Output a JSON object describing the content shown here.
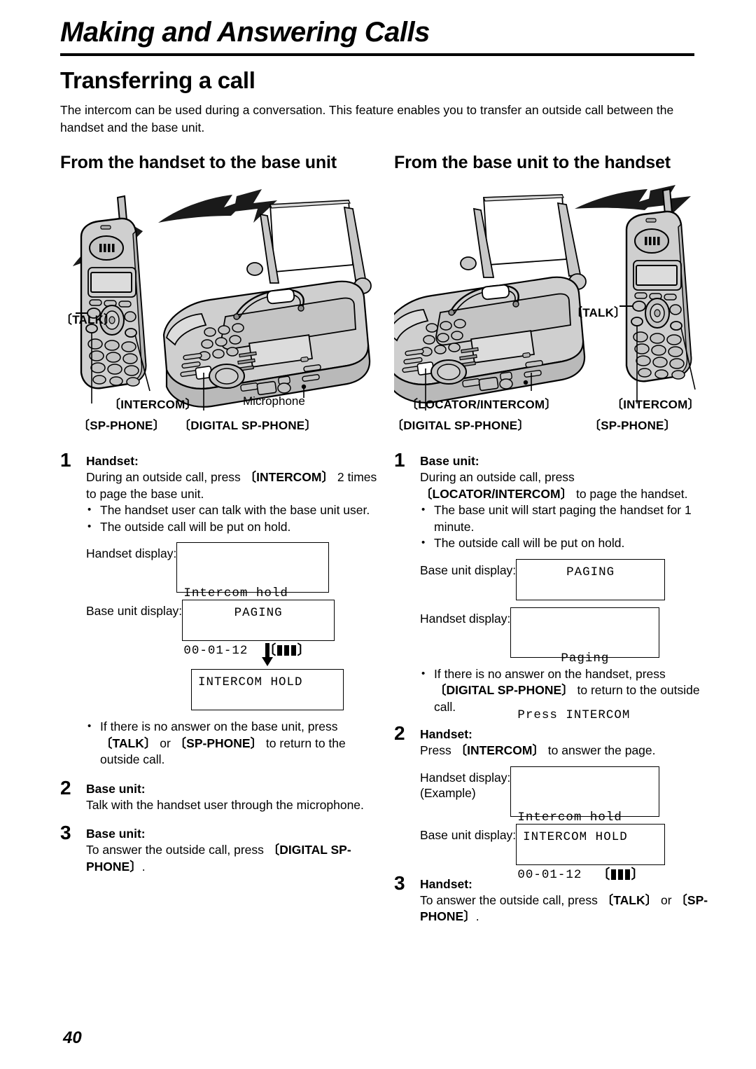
{
  "header": {
    "chapter_title": "Making and Answering Calls",
    "section_title": "Transferring a call",
    "intro": "The intercom can be used during a conversation. This feature enables you to transfer an outside call between the handset and the base unit."
  },
  "left_column": {
    "heading": "From the handset to the base unit",
    "illustration": {
      "callouts": {
        "talk": "〔TALK〕",
        "intercom": "〔INTERCOM〕",
        "sp_phone": "〔SP-PHONE〕",
        "digital_sp_phone": "〔DIGITAL SP-PHONE〕",
        "microphone": "Microphone"
      }
    },
    "steps": [
      {
        "num": "1",
        "role": "Handset:",
        "body_pre": "During an outside call, press ",
        "body_key": "〔INTERCOM〕",
        "body_post": " 2 times to page the base unit.",
        "bullets": [
          "The handset user can talk with the base unit user.",
          "The outside call will be put on hold."
        ],
        "displays": [
          {
            "label": "Handset display:",
            "line1": "Intercom hold",
            "line2": "00-01-12",
            "battery": true
          },
          {
            "label": "Base unit display:",
            "line1": "PAGING",
            "centered": true
          },
          {
            "label": "",
            "line1": "INTERCOM HOLD",
            "arrow_above": true
          }
        ],
        "bullets_after": [
          {
            "pre": "If there is no answer on the base unit, press ",
            "key1": "〔TALK〕",
            "mid": " or ",
            "key2": "〔SP-PHONE〕",
            "post": " to return to the outside call."
          }
        ]
      },
      {
        "num": "2",
        "role": "Base unit:",
        "body_pre": "Talk with the handset user through the microphone.",
        "body_key": "",
        "body_post": ""
      },
      {
        "num": "3",
        "role": "Base unit:",
        "body_pre": "To answer the outside call, press ",
        "body_key": "〔DIGITAL SP-PHONE〕",
        "body_post": "."
      }
    ]
  },
  "right_column": {
    "heading": "From the base unit to the handset",
    "illustration": {
      "callouts": {
        "talk": "〔TALK〕",
        "locator_intercom": "〔LOCATOR/INTERCOM〕",
        "digital_sp_phone": "〔DIGITAL SP-PHONE〕",
        "intercom": "〔INTERCOM〕",
        "sp_phone": "〔SP-PHONE〕"
      }
    },
    "steps": [
      {
        "num": "1",
        "role": "Base unit:",
        "body_pre": "During an outside call, press ",
        "body_key": "〔LOCATOR/INTERCOM〕",
        "body_post": " to page the handset.",
        "bullets": [
          "The base unit will start paging the handset for 1 minute.",
          "The outside call will be put on hold."
        ],
        "displays": [
          {
            "label": "Base unit display:",
            "line1": "PAGING",
            "centered": true
          },
          {
            "label": "Handset display:",
            "line1": "Paging",
            "line2": "Press INTERCOM",
            "centered_first": true
          }
        ],
        "bullets_after": [
          {
            "pre": "If there is no answer on the handset, press ",
            "key1": "〔DIGITAL SP-PHONE〕",
            "mid": "",
            "key2": "",
            "post": " to return to the outside call."
          }
        ]
      },
      {
        "num": "2",
        "role": "Handset:",
        "body_pre": "Press ",
        "body_key": "〔INTERCOM〕",
        "body_post": " to answer the page.",
        "displays": [
          {
            "label": "Handset display:",
            "label_sub": "(Example)",
            "line1": "Intercom hold",
            "line2": "00-01-12",
            "battery": true
          },
          {
            "label": "Base unit display:",
            "line1": "INTERCOM HOLD"
          }
        ]
      },
      {
        "num": "3",
        "role": "Handset:",
        "body_pre": "To answer the outside call, press ",
        "body_key": "〔TALK〕",
        "body_mid": " or ",
        "body_key2": "〔SP-PHONE〕",
        "body_post": "."
      }
    ]
  },
  "footer": {
    "page_number": "40"
  }
}
